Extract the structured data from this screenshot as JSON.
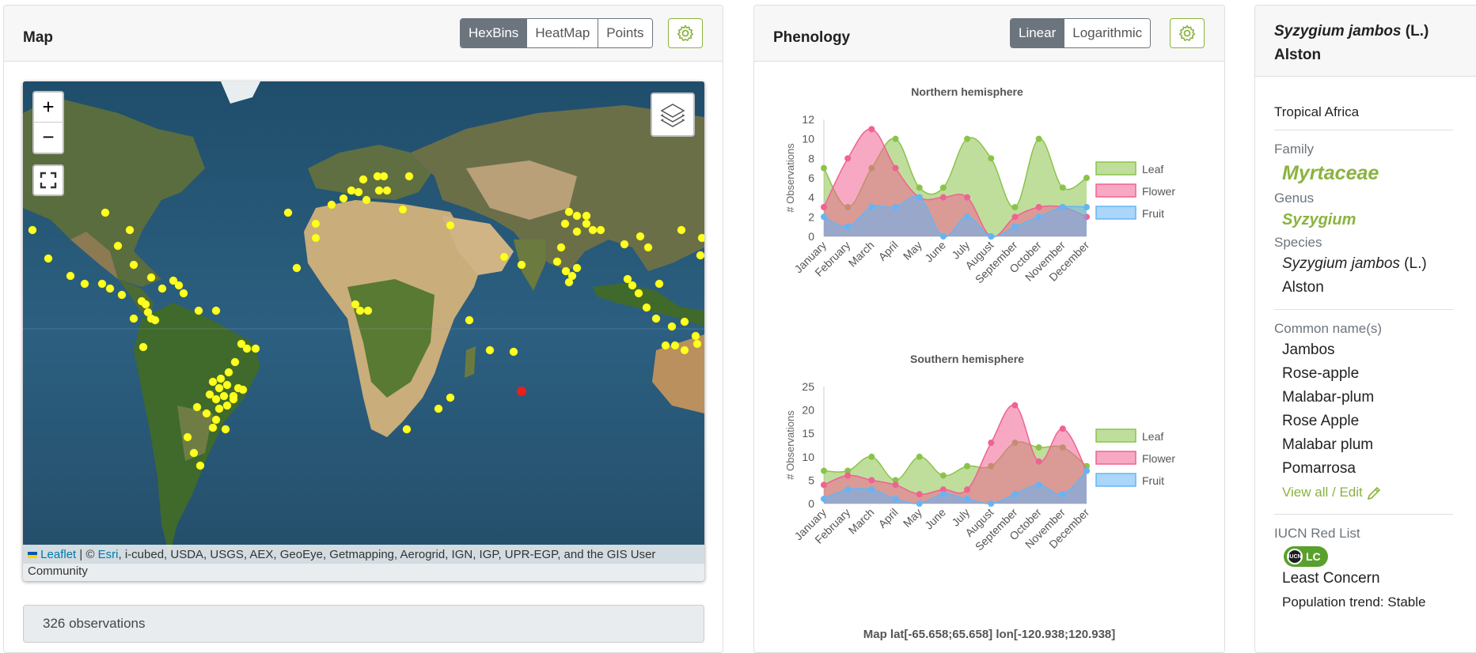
{
  "map_card": {
    "title": "Map",
    "view_buttons": [
      "HexBins",
      "HeatMap",
      "Points"
    ],
    "active_view": "HexBins",
    "gear_icon": "gear-icon",
    "zoom_in": "+",
    "zoom_out": "−",
    "attribution": {
      "leaflet": "Leaflet",
      "sep": " | © ",
      "esri": "Esri",
      "rest": ", i-cubed, USDA, USGS, AEX, GeoEye, Getmapping, Aerogrid, IGN, IGP, UPR-EGP, and the GIS User Community"
    },
    "observations": "326 observations"
  },
  "phenology_card": {
    "title": "Phenology",
    "scale_buttons": [
      "Linear",
      "Logarithmic"
    ],
    "active_scale": "Linear",
    "map_note": "Map lat[-65.658;65.658] lon[-120.938;120.938]"
  },
  "chart_data": [
    {
      "type": "area",
      "title": "Northern hemisphere",
      "ylabel": "# Observations",
      "xlabel": "",
      "categories": [
        "January",
        "February",
        "March",
        "April",
        "May",
        "June",
        "July",
        "August",
        "September",
        "October",
        "November",
        "December"
      ],
      "ylim": [
        0,
        12
      ],
      "yticks": [
        0,
        2,
        4,
        6,
        8,
        10,
        12
      ],
      "legend_position": "right",
      "series": [
        {
          "name": "Leaf",
          "color": "#8bc34a",
          "values": [
            7,
            3,
            7,
            10,
            5,
            5,
            10,
            8,
            3,
            10,
            5,
            6
          ]
        },
        {
          "name": "Flower",
          "color": "#f06292",
          "values": [
            3,
            8,
            11,
            7,
            4,
            4,
            4,
            0,
            2,
            3,
            3,
            2
          ]
        },
        {
          "name": "Fruit",
          "color": "#64b5f6",
          "values": [
            2,
            1,
            3,
            3,
            4,
            0,
            2,
            0,
            1,
            2,
            3,
            3
          ]
        }
      ]
    },
    {
      "type": "area",
      "title": "Southern hemisphere",
      "ylabel": "# Observations",
      "xlabel": "",
      "categories": [
        "January",
        "February",
        "March",
        "April",
        "May",
        "June",
        "July",
        "August",
        "September",
        "October",
        "November",
        "December"
      ],
      "ylim": [
        0,
        25
      ],
      "yticks": [
        0,
        5,
        10,
        15,
        20,
        25
      ],
      "legend_position": "right",
      "series": [
        {
          "name": "Leaf",
          "color": "#8bc34a",
          "values": [
            7,
            7,
            10,
            5,
            10,
            6,
            8,
            8,
            13,
            12,
            12,
            8
          ]
        },
        {
          "name": "Flower",
          "color": "#f06292",
          "values": [
            4,
            6,
            5,
            4,
            2,
            3,
            3,
            13,
            21,
            9,
            16,
            7
          ]
        },
        {
          "name": "Fruit",
          "color": "#64b5f6",
          "values": [
            1,
            3,
            3,
            1,
            0,
            2,
            1,
            0,
            2,
            4,
            2,
            7
          ]
        }
      ]
    }
  ],
  "taxon_card": {
    "name_italic": "Syzygium jambos",
    "name_author_1": " (L.)",
    "name_author_2": "Alston",
    "region": "Tropical Africa",
    "family_label": "Family",
    "family": "Myrtaceae",
    "genus_label": "Genus",
    "genus": "Syzygium",
    "species_label": "Species",
    "species_italic": "Syzygium jambos",
    "species_author_1": " (L.)",
    "species_author_2": "Alston",
    "common_label": "Common name(s)",
    "common_names": [
      "Jambos",
      "Rose-apple",
      "Malabar-plum",
      "Rose Apple",
      "Malabar plum",
      "Pomarrosa"
    ],
    "view_all": "View all / Edit",
    "iucn_label": "IUCN Red List",
    "iucn_code": "LC",
    "iucn_status": "Least Concern",
    "population_trend": "Population trend: Stable"
  }
}
